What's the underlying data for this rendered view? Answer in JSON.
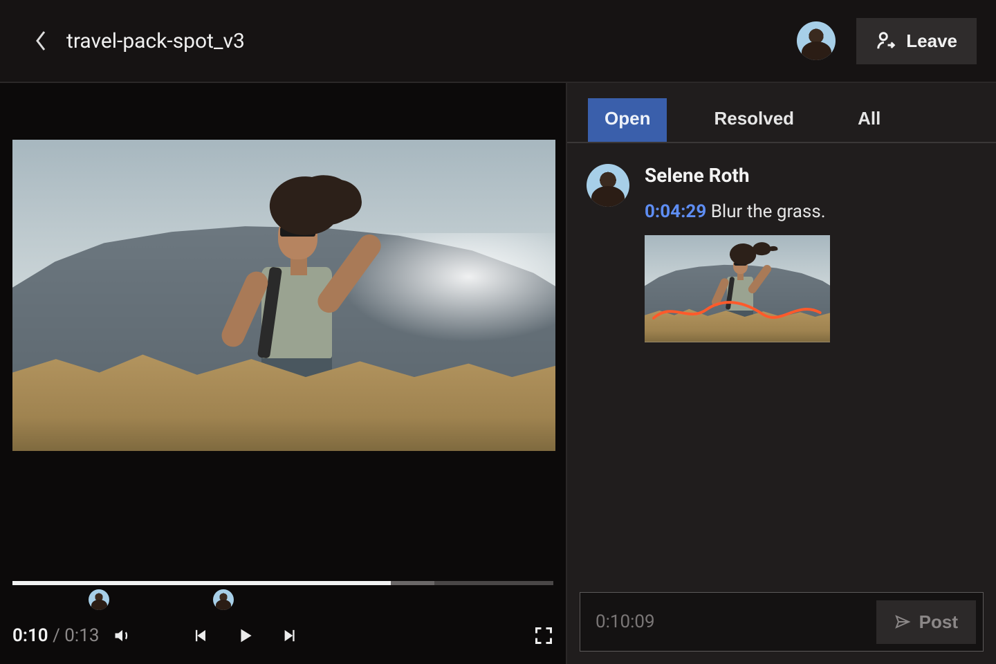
{
  "header": {
    "filename": "travel-pack-spot_v3",
    "leave_label": "Leave"
  },
  "player": {
    "current": "0:10",
    "duration": "0:13",
    "progress_pct": 70,
    "buffer_start_pct": 70,
    "buffer_end_pct": 78,
    "markers_pct": [
      16,
      39
    ]
  },
  "sidebar": {
    "tabs": [
      "Open",
      "Resolved",
      "All"
    ],
    "active_tab_index": 0
  },
  "comments": [
    {
      "author": "Selene Roth",
      "timestamp": "0:04:29",
      "text": "Blur the grass."
    }
  ],
  "composer": {
    "timestamp": "0:10:09",
    "post_label": "Post"
  }
}
